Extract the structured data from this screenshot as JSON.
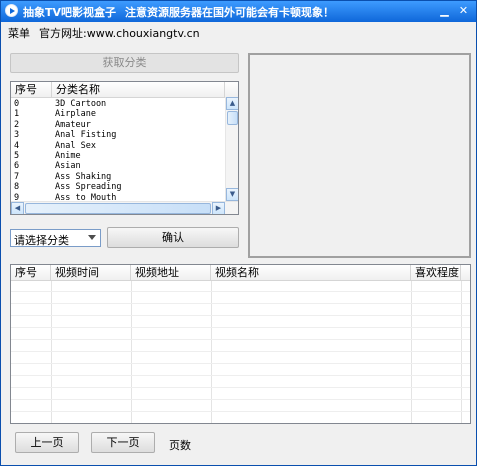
{
  "window": {
    "title": "抽象TV吧影视盒子",
    "notice": "注意资源服务器在国外可能会有卡顿现象！",
    "minimize_glyph": "▁",
    "close_glyph": "✕"
  },
  "menu": {
    "menu_label": "菜单",
    "website_label": "官方网址:www.chouxiangtv.cn"
  },
  "fetch_button": "获取分类",
  "category_list": {
    "columns": [
      "序号",
      "分类名称"
    ],
    "rows": [
      [
        "0",
        "3D Cartoon"
      ],
      [
        "1",
        "Airplane"
      ],
      [
        "2",
        "Amateur"
      ],
      [
        "3",
        "Anal Fisting"
      ],
      [
        "4",
        "Anal Sex"
      ],
      [
        "5",
        "Anime"
      ],
      [
        "6",
        "Asian"
      ],
      [
        "7",
        "Ass Shaking"
      ],
      [
        "8",
        "Ass Spreading"
      ],
      [
        "9",
        "Ass to Mouth"
      ]
    ]
  },
  "category_select": {
    "value": "请选择分类"
  },
  "confirm_button": "确认",
  "video_list": {
    "columns": [
      "序号",
      "视频时间",
      "视频地址",
      "视频名称",
      "喜欢程度"
    ],
    "rows": []
  },
  "pagination": {
    "prev_label": "上一页",
    "next_label": "下一页",
    "pages_label": "页数"
  },
  "colors": {
    "titlebar": "#1c7ae8",
    "window_bg": "#f0f0f0",
    "border": "#0a4fae"
  }
}
